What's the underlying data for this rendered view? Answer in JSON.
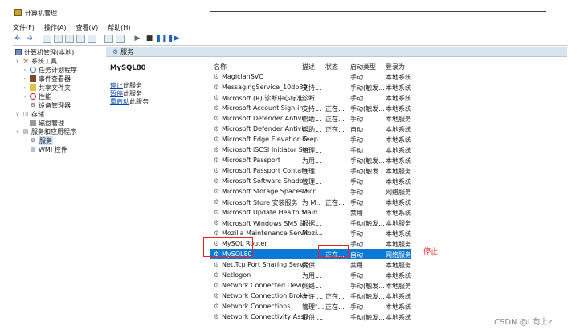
{
  "window": {
    "title": "计算机管理"
  },
  "menu": [
    "文件(F)",
    "操作(A)",
    "查看(V)",
    "帮助(H)"
  ],
  "toolbar": {
    "buttons": [
      "back-icon",
      "forward-icon",
      "up-folder-icon",
      "show-hide-tree-icon",
      "properties-icon",
      "help-icon",
      "export-icon",
      "view-icon",
      "console-icon",
      "play-icon",
      "stop-icon",
      "pause-icon",
      "restart-icon"
    ]
  },
  "tree": {
    "root": "计算机管理(本地)",
    "system_tools": "系统工具",
    "task_scheduler": "任务计划程序",
    "event_viewer": "事件查看器",
    "shared_folders": "共享文件夹",
    "performance": "性能",
    "device_manager": "设备管理器",
    "storage": "存储",
    "disk_management": "磁盘管理",
    "services_apps": "服务和应用程序",
    "services": "服务",
    "wmi": "WMI 控件"
  },
  "panel": {
    "header": "服务",
    "selected_service": "MySQL80",
    "actions": [
      {
        "link": "停止",
        "rest": "此服务"
      },
      {
        "link": "暂停",
        "rest": "此服务"
      },
      {
        "link": "重启动",
        "rest": "此服务"
      }
    ]
  },
  "columns": {
    "name": "名称",
    "desc": "描述",
    "status": "状态",
    "startup": "启动类型",
    "logon": "登录为"
  },
  "services": [
    {
      "name": "MagicianSVC",
      "desc": "",
      "status": "",
      "startup": "手动",
      "logon": "本地系统"
    },
    {
      "name": "MessagingService_10db89",
      "desc": "支持...",
      "status": "",
      "startup": "手动(触发...",
      "logon": "本地系统"
    },
    {
      "name": "Microsoft (R) 诊断中心标准...",
      "desc": "诊断...",
      "status": "",
      "startup": "手动",
      "logon": "本地系统"
    },
    {
      "name": "Microsoft Account Sign-in ...",
      "desc": "支持...",
      "status": "正在...",
      "startup": "手动(触发...",
      "logon": "本地系统"
    },
    {
      "name": "Microsoft Defender Antivir...",
      "desc": "帮助...",
      "status": "正在...",
      "startup": "手动",
      "logon": "本地服务"
    },
    {
      "name": "Microsoft Defender Antivir...",
      "desc": "帮助...",
      "status": "正在...",
      "startup": "自动",
      "logon": "本地系统"
    },
    {
      "name": "Microsoft Edge Elevation S...",
      "desc": "Keep...",
      "status": "",
      "startup": "手动",
      "logon": "本地系统"
    },
    {
      "name": "Microsoft iSCSI Initiator Ser...",
      "desc": "管理...",
      "status": "",
      "startup": "手动",
      "logon": "本地系统"
    },
    {
      "name": "Microsoft Passport",
      "desc": "为用...",
      "status": "",
      "startup": "手动(触发...",
      "logon": "本地系统"
    },
    {
      "name": "Microsoft Passport Container",
      "desc": "管理...",
      "status": "",
      "startup": "手动(触发...",
      "logon": "本地服务"
    },
    {
      "name": "Microsoft Software Shado...",
      "desc": "管理...",
      "status": "",
      "startup": "手动",
      "logon": "本地系统"
    },
    {
      "name": "Microsoft Storage Spaces S...",
      "desc": "Micr...",
      "status": "",
      "startup": "手动",
      "logon": "网络服务"
    },
    {
      "name": "Microsoft Store 安装服务",
      "desc": "为 M...",
      "status": "正在...",
      "startup": "手动",
      "logon": "本地系统"
    },
    {
      "name": "Microsoft Update Health S...",
      "desc": "Main...",
      "status": "",
      "startup": "禁用",
      "logon": "本地系统"
    },
    {
      "name": "Microsoft Windows SMS 路...",
      "desc": "根据...",
      "status": "",
      "startup": "手动(触发...",
      "logon": "本地服务"
    },
    {
      "name": "Mozilla Maintenance Service",
      "desc": "Mozi...",
      "status": "",
      "startup": "手动",
      "logon": "本地系统"
    },
    {
      "name": "MySQL Router",
      "desc": "",
      "status": "",
      "startup": "手动",
      "logon": "本地服务"
    },
    {
      "name": "MySQL80",
      "desc": "",
      "status": "正在...",
      "startup": "自动",
      "logon": "网络服务"
    },
    {
      "name": "Net.Tcp Port Sharing Service",
      "desc": "提供...",
      "status": "",
      "startup": "禁用",
      "logon": "本地服务"
    },
    {
      "name": "Netlogon",
      "desc": "为用...",
      "status": "",
      "startup": "手动",
      "logon": "本地系统"
    },
    {
      "name": "Network Connected Devic...",
      "desc": "网络...",
      "status": "",
      "startup": "手动(触发...",
      "logon": "本地服务"
    },
    {
      "name": "Network Connection Broker",
      "desc": "允许 ...",
      "status": "正在...",
      "startup": "手动(触发...",
      "logon": "本地系统"
    },
    {
      "name": "Network Connections",
      "desc": "管理\"...",
      "status": "正在...",
      "startup": "手动",
      "logon": "本地系统"
    },
    {
      "name": "Network Connectivity Assis...",
      "desc": "提供 ...",
      "status": "",
      "startup": "手动(触发...",
      "logon": "本地系统"
    }
  ],
  "selected_index": 17,
  "annotation": {
    "text": "停止",
    "color": "#e22222"
  },
  "watermark": "CSDN @L向上z"
}
